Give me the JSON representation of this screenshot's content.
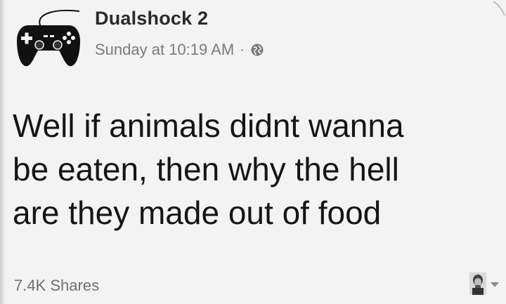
{
  "post": {
    "author": "Dualshock 2",
    "timestamp": "Sunday at 10:19 AM",
    "separator": "·",
    "privacy_icon": "globe-icon",
    "avatar_icon": "gamepad-icon",
    "text_lines": [
      "Well if animals didnt wanna",
      "be eaten, then why the hell",
      "are they made out of food"
    ],
    "shares": "7.4K Shares",
    "reactor_icon": "profile-thumbnail-icon",
    "reactor_menu_icon": "caret-down-icon"
  },
  "colors": {
    "background": "#f3f3f3",
    "text": "#151515",
    "muted": "#7a7a7a"
  }
}
